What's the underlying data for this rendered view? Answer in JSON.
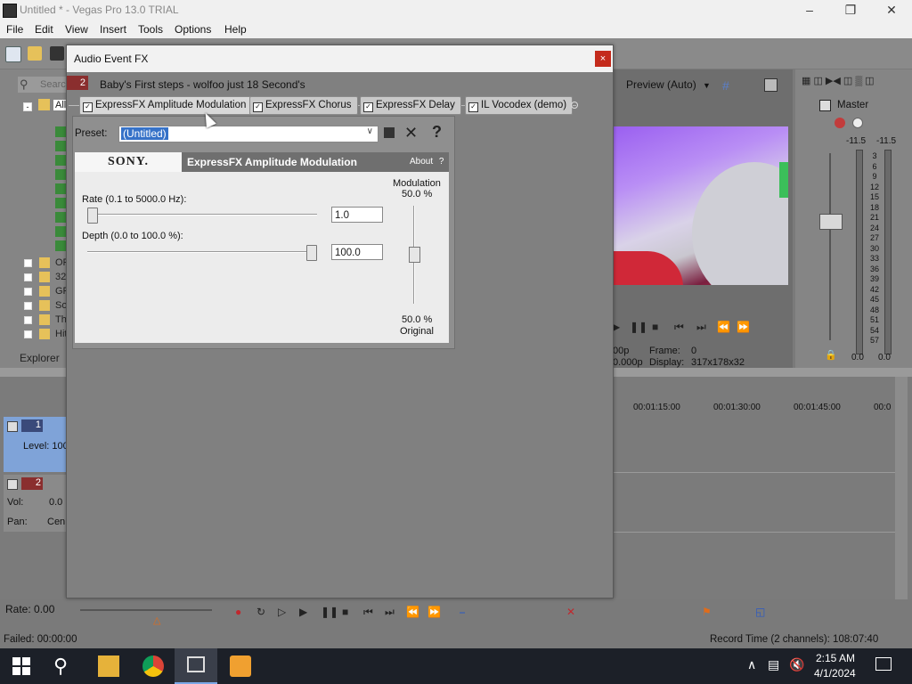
{
  "window": {
    "title": "Untitled * - Vegas Pro 13.0 TRIAL"
  },
  "menu": [
    "File",
    "Edit",
    "View",
    "Insert",
    "Tools",
    "Options",
    "Help"
  ],
  "explorer": {
    "search_placeholder": "Search",
    "all_label": "All",
    "folders": [
      "OF",
      "32",
      "GF",
      "So",
      "Th",
      "Hit"
    ],
    "tab_label": "Explorer"
  },
  "preview": {
    "mode": "Preview (Auto)",
    "frame_label": "Frame:",
    "frame_value": "0",
    "display_label": "Display:",
    "display_value": "317x178x32",
    "left_top": "00p",
    "left_bottom": "0.000p"
  },
  "master": {
    "title": "Master",
    "peak_left": "-11.5",
    "peak_right": "-11.5",
    "db_scale": [
      "3",
      "6",
      "9",
      "12",
      "15",
      "18",
      "21",
      "24",
      "27",
      "30",
      "33",
      "36",
      "39",
      "42",
      "45",
      "48",
      "51",
      "54",
      "57"
    ],
    "out_left": "0.0",
    "out_right": "0.0"
  },
  "timeline": {
    "time_markers": [
      "00:01:15:00",
      "00:01:30:00",
      "00:01:45:00",
      "00:0"
    ],
    "track1": {
      "number": "1",
      "level_label": "Level: 100"
    },
    "track2": {
      "number": "2",
      "vol_label": "Vol:",
      "vol_value": "0.0",
      "pan_label": "Pan:",
      "pan_value": "Cen"
    },
    "rate_label": "Rate: 0.00"
  },
  "status": {
    "left": "Failed: 00:00:00",
    "right": "Record Time (2 channels): 108:07:40"
  },
  "dialog": {
    "title": "Audio Event FX",
    "close_glyph": "×",
    "event_number": "2",
    "event_name": "Baby's First steps - wolfoo  just 18 Second's",
    "chain": [
      {
        "label": "ExpressFX Amplitude Modulation",
        "checked": true
      },
      {
        "label": "ExpressFX Chorus",
        "checked": true
      },
      {
        "label": "ExpressFX Delay",
        "checked": true
      },
      {
        "label": "IL Vocodex (demo)",
        "checked": true
      }
    ],
    "preset_label": "Preset:",
    "preset_value": "(Untitled)",
    "help_glyph": "?",
    "plugin": {
      "brand": "SONY.",
      "name": "ExpressFX Amplitude Modulation",
      "about": "About",
      "about_q": "?",
      "rate_label": "Rate (0.1 to 5000.0 Hz):",
      "rate_value": "1.0",
      "rate_fraction": 0.0,
      "depth_label": "Depth (0.0 to 100.0 %):",
      "depth_value": "100.0",
      "depth_fraction": 1.0,
      "modulation_label": "Modulation",
      "modulation_top": "50.0 %",
      "modulation_bottom": "50.0 %",
      "original_label": "Original",
      "modulation_fraction": 0.5
    }
  },
  "taskbar": {
    "time": "2:15 AM",
    "date": "4/1/2024"
  },
  "colors": {
    "accent": "#3672c8",
    "close_red": "#c42b1c",
    "track_blue": "#7fa3d8",
    "track_red": "#a03030"
  }
}
